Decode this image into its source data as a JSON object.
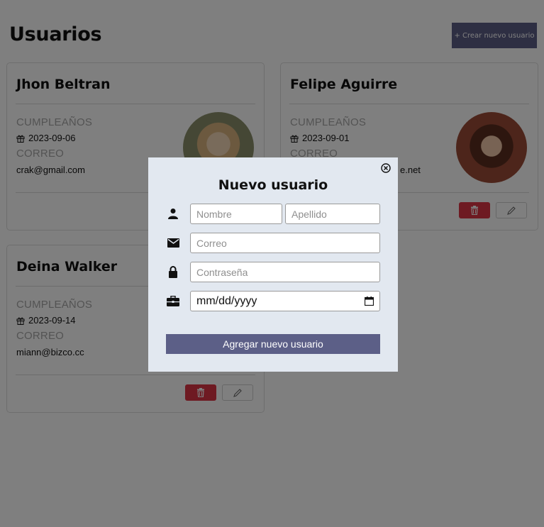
{
  "page": {
    "title": "Usuarios"
  },
  "header": {
    "create_button": "+ Crear nuevo usuario"
  },
  "users": [
    {
      "name": "Jhon Beltran",
      "birthday_label": "CUMPLEAÑOS",
      "birthday": "2023-09-06",
      "email_label": "CORREO",
      "email": "crak@gmail.com"
    },
    {
      "name": "Felipe Aguirre",
      "birthday_label": "CUMPLEAÑOS",
      "birthday": "2023-09-01",
      "email_label": "CORREO",
      "email": "e.net"
    },
    {
      "name": "Deina Walker",
      "birthday_label": "CUMPLEAÑOS",
      "birthday": "2023-09-14",
      "email_label": "CORREO",
      "email": "miann@bizco.cc"
    }
  ],
  "modal": {
    "title": "Nuevo usuario",
    "first_name_placeholder": "Nombre",
    "last_name_placeholder": "Apellido",
    "email_placeholder": "Correo",
    "password_placeholder": "Contraseña",
    "date_value": "mm/dd/yyyy",
    "submit_label": "Agregar nuevo usuario"
  },
  "colors": {
    "primary": "#5c5f87",
    "danger": "#dc3545",
    "modal_bg": "#e2e8f0"
  },
  "icons": [
    "gift-icon",
    "user-icon",
    "envelope-icon",
    "lock-icon",
    "briefcase-icon",
    "calendar-icon",
    "trash-icon",
    "pencil-icon",
    "close-icon"
  ]
}
